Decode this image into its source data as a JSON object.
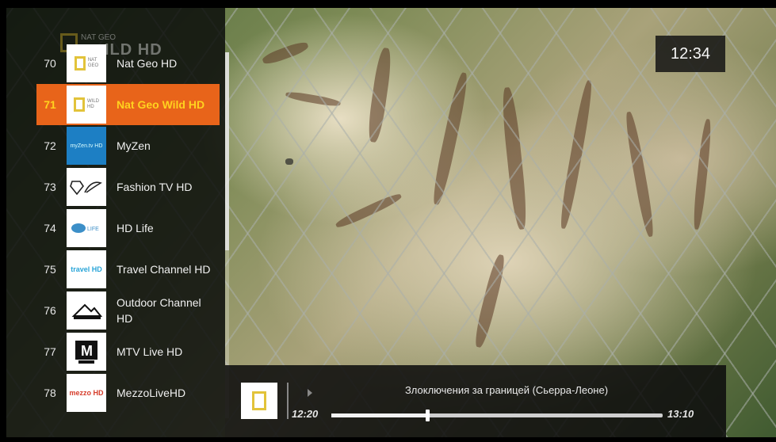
{
  "panel": {
    "header_small": "NAT GEO",
    "header_big": "ILD HD"
  },
  "channels": [
    {
      "number": "70",
      "name": "Nat Geo HD",
      "logo": "nat-geo-logo"
    },
    {
      "number": "71",
      "name": "Nat Geo Wild HD",
      "logo": "nat-geo-wild-logo",
      "selected": true
    },
    {
      "number": "72",
      "name": "MyZen",
      "logo": "myzen-logo",
      "logo_text": "myZen.tv HD"
    },
    {
      "number": "73",
      "name": "Fashion TV HD",
      "logo": "fashion-tv-logo"
    },
    {
      "number": "74",
      "name": "HD Life",
      "logo": "hd-life-logo",
      "logo_text": "LIFE"
    },
    {
      "number": "75",
      "name": "Travel Channel HD",
      "logo": "travel-channel-logo",
      "logo_text": "travel HD"
    },
    {
      "number": "76",
      "name": "Outdoor Channel HD",
      "logo": "outdoor-channel-logo"
    },
    {
      "number": "77",
      "name": "MTV Live HD",
      "logo": "mtv-live-logo",
      "logo_text": "M"
    },
    {
      "number": "78",
      "name": "MezzoLiveHD",
      "logo": "mezzo-logo",
      "logo_text": "mezzo HD"
    }
  ],
  "clock": "12:34",
  "program": {
    "title": "Злоключения за границей (Сьерра-Леоне)",
    "start": "12:20",
    "end": "13:10",
    "progress": 0.29
  },
  "colors": {
    "selected_bg": "#e8641a",
    "selected_text": "#ffd21f"
  }
}
